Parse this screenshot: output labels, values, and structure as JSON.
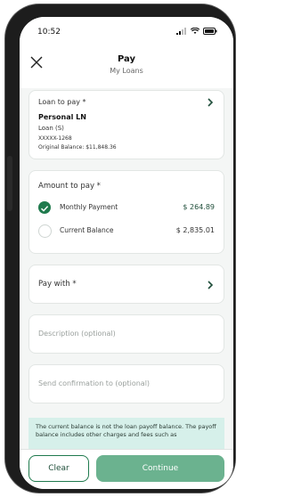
{
  "status_bar": {
    "time": "10:52"
  },
  "header": {
    "title": "Pay",
    "subtitle": "My Loans"
  },
  "loan_card": {
    "label": "Loan to pay *",
    "loan_name": "Personal LN",
    "loan_type": "Loan (S)",
    "account": "XXXXX-1268",
    "original_balance": "Original Balance: $11,848.36"
  },
  "amount_card": {
    "label": "Amount to pay *",
    "options": [
      {
        "label": "Monthly Payment",
        "amount": "$ 264.89",
        "selected": true
      },
      {
        "label": "Current Balance",
        "amount": "$ 2,835.01",
        "selected": false
      }
    ]
  },
  "pay_with": {
    "label": "Pay with *"
  },
  "description": {
    "placeholder": "Description (optional)"
  },
  "confirmation": {
    "placeholder": "Send confirmation to (optional)"
  },
  "notice": {
    "text": "The current balance is not the loan payoff balance. The payoff balance includes other charges and fees such as"
  },
  "footer": {
    "clear_label": "Clear",
    "continue_label": "Continue"
  },
  "colors": {
    "accent": "#1f7a4d",
    "continue": "#6bb28f",
    "notice_bg": "#d6f0ea"
  },
  "icons": {
    "close": "close-icon",
    "chevron": "chevron-right-icon",
    "check": "check-icon"
  }
}
